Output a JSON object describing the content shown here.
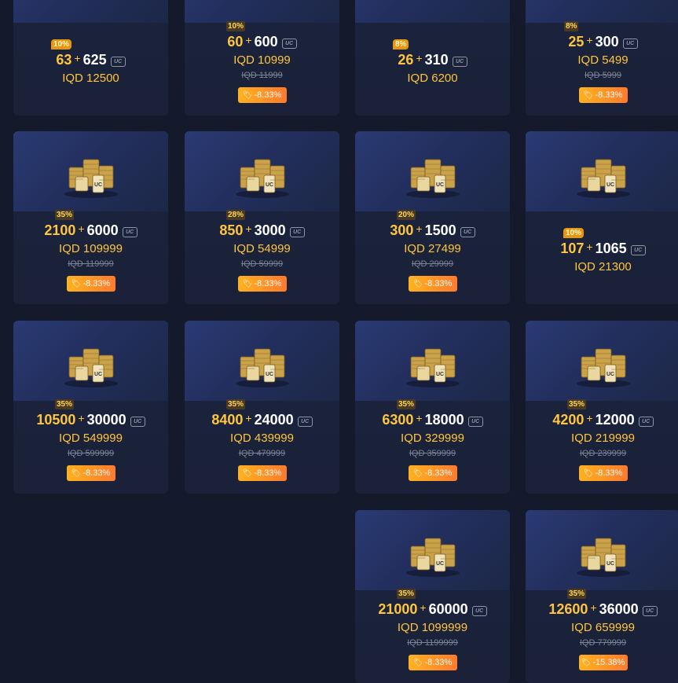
{
  "currency_icon": "uc-icon",
  "discount_icon": "price-tag-icon",
  "cards": [
    {
      "tag": "10%",
      "tag_style": "orange",
      "bonus": "63",
      "base": "625",
      "price": "IQD 12500",
      "old": "",
      "discount": ""
    },
    {
      "tag": "10%",
      "tag_style": "plain",
      "bonus": "60",
      "base": "600",
      "price": "IQD 10999",
      "old": "IQD 11999",
      "discount": "-8.33%"
    },
    {
      "tag": "8%",
      "tag_style": "orange",
      "bonus": "26",
      "base": "310",
      "price": "IQD 6200",
      "old": "",
      "discount": ""
    },
    {
      "tag": "8%",
      "tag_style": "plain",
      "bonus": "25",
      "base": "300",
      "price": "IQD 5499",
      "old": "IQD 5999",
      "discount": "-8.33%"
    },
    {
      "tag": "35%",
      "tag_style": "plain",
      "bonus": "2100",
      "base": "6000",
      "price": "IQD 109999",
      "old": "IQD 119999",
      "discount": "-8.33%"
    },
    {
      "tag": "28%",
      "tag_style": "plain",
      "bonus": "850",
      "base": "3000",
      "price": "IQD 54999",
      "old": "IQD 59999",
      "discount": "-8.33%"
    },
    {
      "tag": "20%",
      "tag_style": "plain",
      "bonus": "300",
      "base": "1500",
      "price": "IQD 27499",
      "old": "IQD 29999",
      "discount": "-8.33%"
    },
    {
      "tag": "10%",
      "tag_style": "orange",
      "bonus": "107",
      "base": "1065",
      "price": "IQD 21300",
      "old": "",
      "discount": ""
    },
    {
      "tag": "35%",
      "tag_style": "plain",
      "bonus": "10500",
      "base": "30000",
      "price": "IQD 549999",
      "old": "IQD 599999",
      "discount": "-8.33%"
    },
    {
      "tag": "35%",
      "tag_style": "plain",
      "bonus": "8400",
      "base": "24000",
      "price": "IQD 439999",
      "old": "IQD 479999",
      "discount": "-8.33%"
    },
    {
      "tag": "35%",
      "tag_style": "plain",
      "bonus": "6300",
      "base": "18000",
      "price": "IQD 329999",
      "old": "IQD 359999",
      "discount": "-8.33%"
    },
    {
      "tag": "35%",
      "tag_style": "plain",
      "bonus": "4200",
      "base": "12000",
      "price": "IQD 219999",
      "old": "IQD 239999",
      "discount": "-8.33%"
    },
    {
      "tag": "35%",
      "tag_style": "plain",
      "bonus": "21000",
      "base": "60000",
      "price": "IQD 1099999",
      "old": "IQD 1199999",
      "discount": "-8.33%"
    },
    {
      "tag": "35%",
      "tag_style": "plain",
      "bonus": "12600",
      "base": "36000",
      "price": "IQD 659999",
      "old": "IQD 779999",
      "discount": "-15.38%"
    }
  ]
}
